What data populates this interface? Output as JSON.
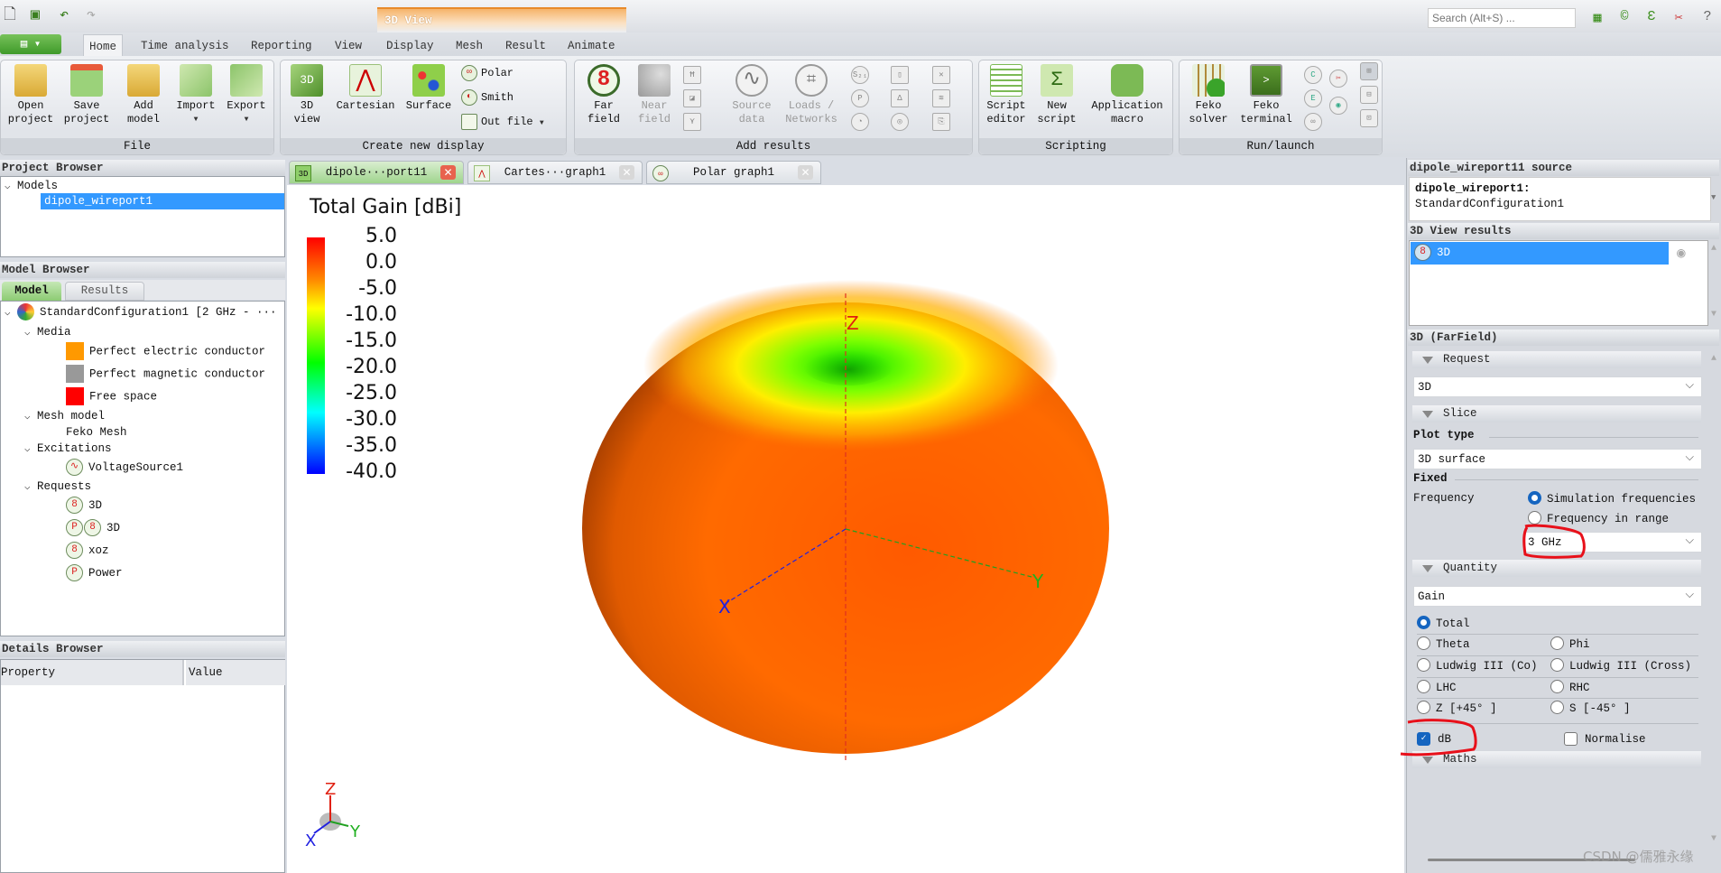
{
  "titlebar": {
    "context_tab": "3D View",
    "search_placeholder": "Search (Alt+S) ..."
  },
  "ribbon_tabs": [
    "Home",
    "Time analysis",
    "Reporting",
    "View",
    "Display",
    "Mesh",
    "Result",
    "Animate"
  ],
  "ribbon": {
    "file": {
      "label": "File",
      "open": [
        "Open",
        "project"
      ],
      "save": [
        "Save",
        "project"
      ],
      "add": [
        "Add",
        "model"
      ],
      "import": "Import",
      "export": "Export"
    },
    "create": {
      "label": "Create new display",
      "view3d": [
        "3D",
        "view"
      ],
      "cartesian": "Cartesian",
      "surface": "Surface",
      "polar": "Polar",
      "smith": "Smith",
      "outfile": "Out file"
    },
    "add_results": {
      "label": "Add results",
      "far": [
        "Far",
        "field"
      ],
      "near": [
        "Near",
        "field"
      ],
      "source": [
        "Source",
        "data"
      ],
      "loads": [
        "Loads /",
        "Networks"
      ]
    },
    "scripting": {
      "label": "Scripting",
      "editor": [
        "Script",
        "editor"
      ],
      "new": [
        "New",
        "script"
      ],
      "macro": [
        "Application",
        "macro"
      ]
    },
    "run": {
      "label": "Run/launch",
      "solver": [
        "Feko",
        "solver"
      ],
      "terminal": [
        "Feko",
        "terminal"
      ]
    }
  },
  "project_browser": {
    "title": "Project Browser",
    "models": "Models",
    "selected": "dipole_wireport1"
  },
  "model_browser": {
    "title": "Model Browser",
    "tabs": [
      "Model",
      "Results"
    ],
    "config": "StandardConfiguration1 [2 GHz - ···",
    "media": "Media",
    "media_items": [
      {
        "label": "Perfect electric conductor",
        "color": "#ff9900"
      },
      {
        "label": "Perfect magnetic conductor",
        "color": "#999999"
      },
      {
        "label": "Free space",
        "color": "#ff0000"
      }
    ],
    "mesh_model": "Mesh model",
    "mesh": "Feko Mesh",
    "excitations": "Excitations",
    "voltage_source": "VoltageSource1",
    "requests": "Requests",
    "request_items": [
      "3D",
      "3D",
      "xoz",
      "Power"
    ]
  },
  "details_browser": {
    "title": "Details Browser",
    "col_property": "Property",
    "col_value": "Value"
  },
  "view_tabs": [
    {
      "label": "dipole···port11",
      "active": true
    },
    {
      "label": "Cartes···graph1",
      "active": false
    },
    {
      "label": "Polar graph1",
      "active": false
    }
  ],
  "colorbar": {
    "title": "Total Gain [dBi]",
    "ticks": [
      "5.0",
      "0.0",
      "-5.0",
      "-10.0",
      "-15.0",
      "-20.0",
      "-25.0",
      "-30.0",
      "-35.0",
      "-40.0"
    ],
    "max": 5.0,
    "min": -40.0
  },
  "axes": {
    "x": "X",
    "y": "Y",
    "z": "Z"
  },
  "right_panel": {
    "source_title": "dipole_wireport11 source",
    "source_model": "dipole_wireport1:",
    "source_config": "StandardConfiguration1",
    "results_title": "3D View results",
    "result_item": "3D",
    "farfield_title": "3D (FarField)",
    "request_section": "Request",
    "request_value": "3D",
    "slice_section": "Slice",
    "plot_type_label": "Plot type",
    "plot_type_value": "3D surface",
    "fixed_label": "Fixed",
    "frequency_label": "Frequency",
    "freq_sim": "Simulation frequencies",
    "freq_range": "Frequency in range",
    "freq_value": "3 GHz",
    "quantity_section": "Quantity",
    "quantity_value": "Gain",
    "components": [
      "Total",
      "Theta",
      "Phi",
      "Ludwig III (Co)",
      "Ludwig III (Cross)",
      "LHC",
      "RHC",
      "Z [+45° ]",
      "S [-45° ]"
    ],
    "selected_component": "Total",
    "db_label": "dB",
    "db_checked": true,
    "normalise_label": "Normalise",
    "normalise_checked": false,
    "maths_section": "Maths"
  },
  "annotation_color": "#e8101a",
  "watermark": "CSDN @儒雅永缘"
}
